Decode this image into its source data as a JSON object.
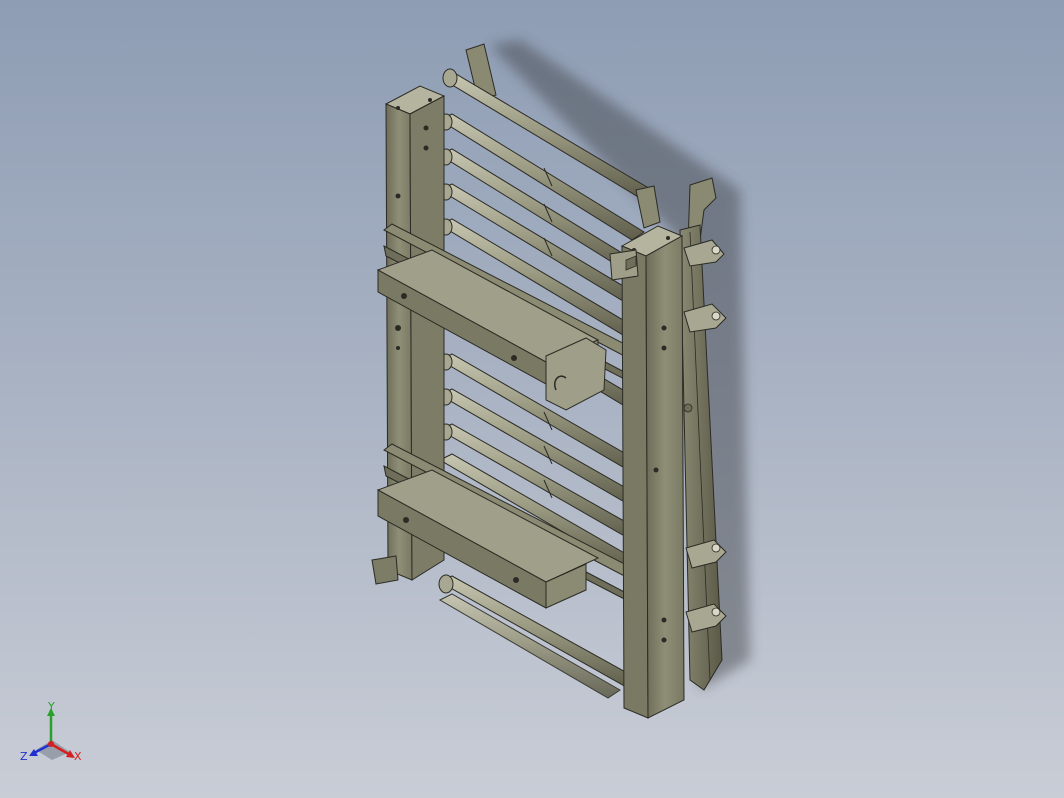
{
  "viewport": {
    "background_top": "#8e9db4",
    "background_bottom": "#c9cdd6",
    "model_color": "#8b8a72",
    "model_shadow": "#4e4d3f",
    "model_highlight": "#b9b8a3",
    "edge_color": "#2b2b25"
  },
  "triad": {
    "x_label": "X",
    "y_label": "Y",
    "z_label": "Z",
    "x_color": "#d42020",
    "y_color": "#2aa02a",
    "z_color": "#2030d0"
  }
}
